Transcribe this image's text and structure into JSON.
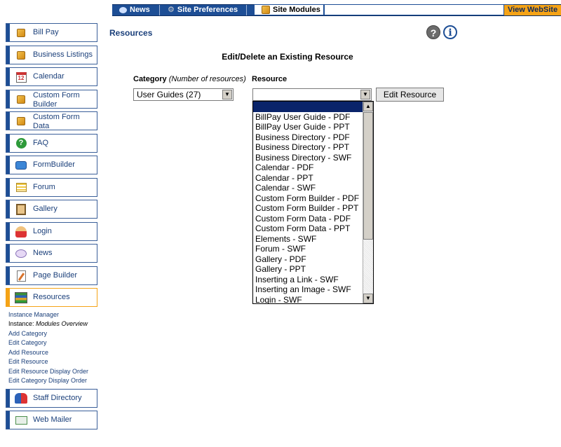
{
  "topnav": {
    "tabs": [
      {
        "label": "News",
        "icon": "speech-bubble-icon"
      },
      {
        "label": "Site Preferences",
        "icon": "gear-icon"
      },
      {
        "label": "Site Modules",
        "icon": "package-icon"
      }
    ],
    "view_website": "View WebSite"
  },
  "sidebar": {
    "modules": [
      {
        "label": "Bill Pay",
        "icon": "package-icon"
      },
      {
        "label": "Business Listings",
        "icon": "package-icon"
      },
      {
        "label": "Calendar",
        "icon": "calendar-icon",
        "icon_text": "12"
      },
      {
        "label": "Custom Form Builder",
        "icon": "package-icon"
      },
      {
        "label": "Custom Form Data",
        "icon": "package-icon"
      },
      {
        "label": "FAQ",
        "icon": "question-icon"
      },
      {
        "label": "FormBuilder",
        "icon": "form-icon"
      },
      {
        "label": "Forum",
        "icon": "forum-icon"
      },
      {
        "label": "Gallery",
        "icon": "gallery-icon"
      },
      {
        "label": "Login",
        "icon": "login-icon"
      },
      {
        "label": "News",
        "icon": "news-icon"
      },
      {
        "label": "Page Builder",
        "icon": "page-builder-icon"
      },
      {
        "label": "Resources",
        "icon": "books-icon",
        "active": true
      },
      {
        "label": "Staff Directory",
        "icon": "staff-icon"
      },
      {
        "label": "Web Mailer",
        "icon": "mail-icon"
      }
    ],
    "sublinks": {
      "instance_manager": "Instance Manager",
      "instance_prefix": "Instance: ",
      "instance_value": "Modules Overview",
      "items": [
        "Add Category",
        "Edit Category",
        "Add Resource",
        "Edit Resource",
        "Edit Resource Display Order",
        "Edit Category Display Order"
      ]
    }
  },
  "main": {
    "page_title": "Resources",
    "heading": "Edit/Delete an Existing Resource",
    "category_label": "Category",
    "category_hint": "(Number of resources)",
    "resource_label": "Resource",
    "category_value": "User Guides (27)",
    "resource_value": "",
    "edit_button": "Edit Resource",
    "resource_options": [
      "",
      "BillPay User Guide - PDF",
      "BillPay User Guide - PPT",
      "Business Directory - PDF",
      "Business Directory - PPT",
      "Business Directory - SWF",
      "Calendar - PDF",
      "Calendar - PPT",
      "Calendar - SWF",
      "Custom Form Builder - PDF",
      "Custom Form Builder - PPT",
      "Custom Form Data - PDF",
      "Custom Form Data - PPT",
      "Elements - SWF",
      "Forum - SWF",
      "Gallery - PDF",
      "Gallery - PPT",
      "Inserting a Link - SWF",
      "Inserting an Image - SWF",
      "Login - SWF"
    ]
  },
  "colors": {
    "nav_blue": "#1d4e95",
    "accent_orange": "#f5a316",
    "selection": "#0a246a"
  }
}
